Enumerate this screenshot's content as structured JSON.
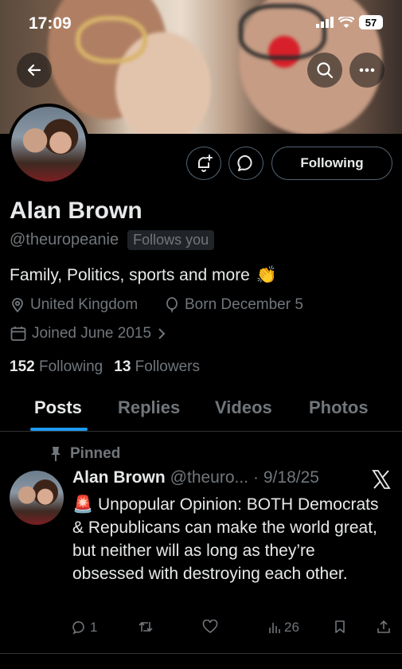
{
  "status_bar": {
    "time": "17:09",
    "battery": "57"
  },
  "profile": {
    "name": "Alan Brown",
    "handle": "@theuropeanie",
    "follows_you": "Follows you",
    "following_button": "Following",
    "bio": "Family, Politics, sports and more",
    "bio_emoji": "👏",
    "location": "United Kingdom",
    "birthday": "Born December 5",
    "joined": "Joined June 2015",
    "following_count": "152",
    "following_label": "Following",
    "followers_count": "13",
    "followers_label": "Followers"
  },
  "tabs": [
    {
      "label": "Posts",
      "active": true
    },
    {
      "label": "Replies",
      "active": false
    },
    {
      "label": "Videos",
      "active": false
    },
    {
      "label": "Photos",
      "active": false
    }
  ],
  "pinned_post": {
    "pinned_label": "Pinned",
    "author_name": "Alan Brown",
    "author_handle": "@theuro...",
    "date": "· 9/18/25",
    "text_emoji": "🚨",
    "text": "Unpopular Opinion: BOTH Democrats & Republicans can make the world great, but neither will as long as they’re obsessed with destroying each other.",
    "replies": "1",
    "views": "26"
  },
  "colors": {
    "accent": "#1d9bf0",
    "muted": "#71767b",
    "text": "#e7e9ea",
    "border": "#536471"
  },
  "icons": [
    "back-arrow-icon",
    "search-icon",
    "more-icon",
    "notification-bell-plus-icon",
    "message-bubble-icon",
    "location-pin-icon",
    "balloon-icon",
    "calendar-icon",
    "chevron-right-icon",
    "pin-icon",
    "x-logo-icon",
    "reply-icon",
    "repost-icon",
    "like-icon",
    "views-icon",
    "bookmark-icon",
    "share-icon"
  ]
}
